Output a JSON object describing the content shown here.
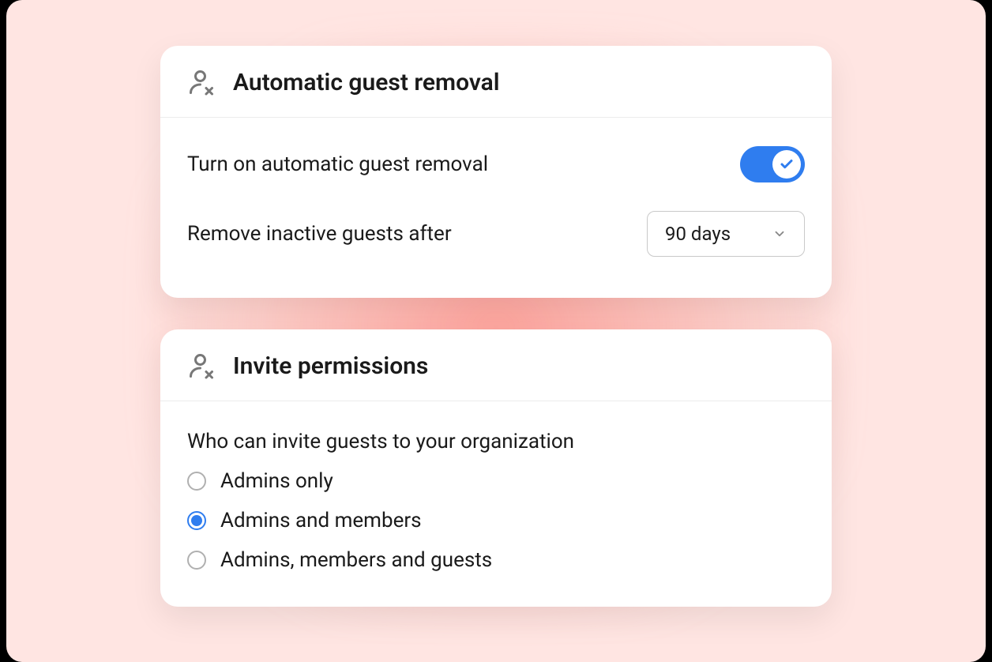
{
  "card1": {
    "title": "Automatic guest removal",
    "toggle_label": "Turn on automatic guest removal",
    "toggle_on": true,
    "remove_after_label": "Remove inactive guests after",
    "remove_after_value": "90 days"
  },
  "card2": {
    "title": "Invite permissions",
    "question": "Who can invite guests to your organization",
    "options": [
      {
        "label": "Admins only",
        "selected": false
      },
      {
        "label": "Admins and members",
        "selected": true
      },
      {
        "label": "Admins, members and guests",
        "selected": false
      }
    ]
  }
}
